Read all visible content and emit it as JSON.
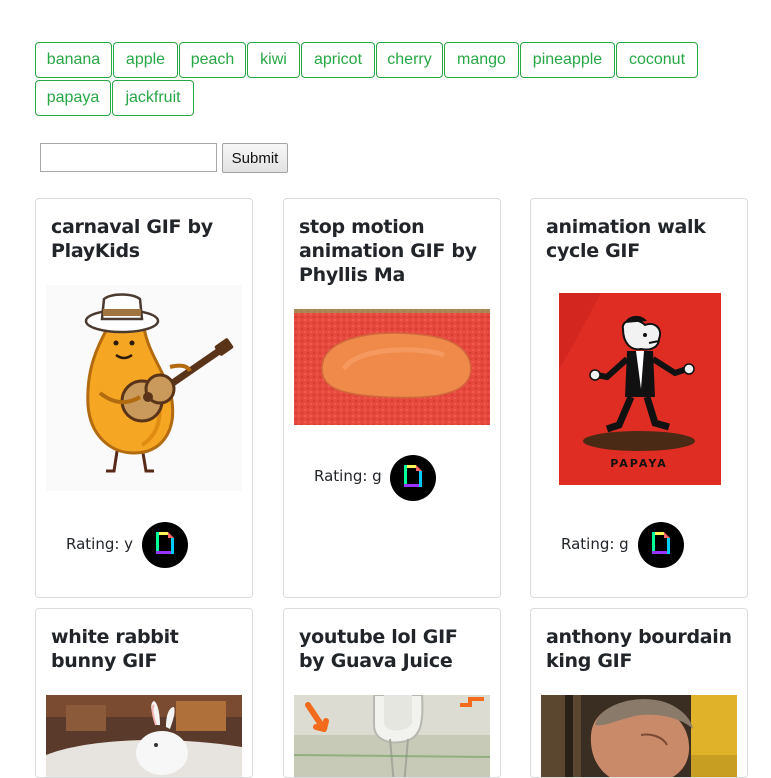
{
  "tags": [
    "banana",
    "apple",
    "peach",
    "kiwi",
    "apricot",
    "cherry",
    "mango",
    "pineapple",
    "coconut",
    "papaya",
    "jackfruit"
  ],
  "search": {
    "value": "",
    "placeholder": "",
    "submit_label": "Submit"
  },
  "cards": [
    {
      "title": "carnaval GIF by PlayKids",
      "rating_label": "Rating: y"
    },
    {
      "title": "stop motion animation GIF by Phyllis Ma",
      "rating_label": "Rating: g"
    },
    {
      "title": "animation walk cycle GIF",
      "rating_label": "Rating: g"
    },
    {
      "title": "white rabbit bunny GIF"
    },
    {
      "title": "youtube lol GIF by Guava Juice"
    },
    {
      "title": "anthony bourdain king GIF"
    }
  ],
  "gif_texts": {
    "papaya_sign": "PAPAYA"
  },
  "icons": {
    "giphy": "giphy-logo-icon"
  },
  "colors": {
    "accent": "#28a745",
    "card_border": "#dcdcdc"
  }
}
